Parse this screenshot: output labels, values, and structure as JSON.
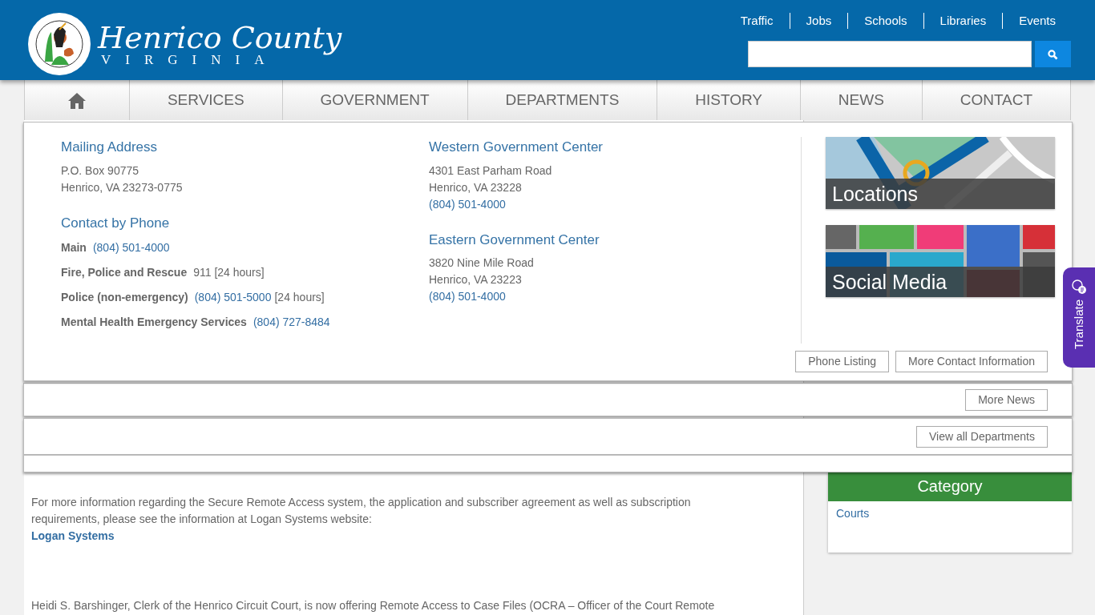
{
  "header": {
    "title": "Henrico County",
    "subtitle": "VIRGINIA",
    "quick_links": [
      "Traffic",
      "Jobs",
      "Schools",
      "Libraries",
      "Events"
    ]
  },
  "nav": {
    "items": [
      {
        "kind": "home"
      },
      {
        "kind": "text",
        "label": "SERVICES"
      },
      {
        "kind": "text",
        "label": "GOVERNMENT"
      },
      {
        "kind": "text",
        "label": "DEPARTMENTS"
      },
      {
        "kind": "text",
        "label": "HISTORY"
      },
      {
        "kind": "text",
        "label": "NEWS"
      },
      {
        "kind": "text",
        "label": "CONTACT"
      }
    ]
  },
  "contact_panel": {
    "mailing": {
      "heading": "Mailing Address",
      "lines": [
        "P.O. Box 90775",
        "Henrico, VA 23273-0775"
      ]
    },
    "phone": {
      "heading": "Contact by Phone",
      "rows": [
        {
          "label": "Main",
          "link": "(804) 501-4000"
        },
        {
          "label": "Fire, Police and Rescue",
          "text": "911 [24 hours]"
        },
        {
          "label": "Police (non-emergency)",
          "link": "(804) 501-5000",
          "text": "[24 hours]"
        },
        {
          "label": "Mental Health Emergency Services",
          "link": "(804) 727-8484"
        }
      ]
    },
    "centers": [
      {
        "heading": "Western Government Center",
        "lines": [
          "4301 East Parham Road",
          "Henrico, VA 23228"
        ],
        "phone": "(804) 501-4000"
      },
      {
        "heading": "Eastern Government Center",
        "lines": [
          "3820 Nine Mile Road",
          "Henrico, VA 23223"
        ],
        "phone": "(804) 501-4000"
      }
    ],
    "tiles": [
      {
        "kind": "map",
        "label": "Locations"
      },
      {
        "kind": "social",
        "label": "Social Media"
      }
    ],
    "buttons": [
      "Phone Listing",
      "More Contact Information"
    ]
  },
  "news_panel": {
    "buttons": [
      "More News"
    ]
  },
  "departments_panel": {
    "buttons": [
      "View all Departments"
    ]
  },
  "content": {
    "paragraphs": [
      {
        "text": "For more information regarding the Secure Remote Access system, the application and subscriber agreement as well as subscription requirements, please see the information at Logan Systems website:",
        "link": "Logan Systems"
      },
      {
        "text": "Heidi S. Barshinger, Clerk of the Henrico Circuit Court, is now offering Remote Access to Case Files (OCRA – Officer of the Court Remote"
      }
    ]
  },
  "sidebar": {
    "heading": "Category",
    "links": [
      "Courts"
    ]
  },
  "translate": {
    "label": "Translate"
  }
}
